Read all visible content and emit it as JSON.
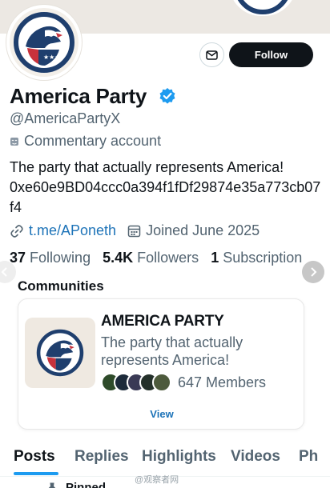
{
  "profile": {
    "name": "America Party",
    "handle": "@AmericaPartyX",
    "category": "Commentary account",
    "bio_line": "The party that actually represents America!",
    "bio_address": "0xe60e9BD04ccc0a394f1fDf29874e35a773cb07f4",
    "link": "t.me/APoneth",
    "joined": "Joined June 2025"
  },
  "actions": {
    "follow_label": "Follow"
  },
  "stats": {
    "following_count": "37",
    "following_label": "Following",
    "followers_count": "5.4K",
    "followers_label": "Followers",
    "subscriptions_count": "1",
    "subscriptions_label": "Subscription"
  },
  "communities": {
    "title": "Communities",
    "card": {
      "name": "AMERICA PARTY",
      "description": "The party that actually represents America!",
      "members": "647 Members",
      "view_label": "View"
    }
  },
  "tabs": [
    "Posts",
    "Replies",
    "Highlights",
    "Videos",
    "Ph"
  ],
  "pinned_label": "Pinned",
  "watermark": "@观察者网",
  "colors": {
    "brand_navy": "#1f3f6e",
    "brand_red": "#c8323c",
    "link_blue": "#1d73b8",
    "verified_blue": "#1d9bf0",
    "text_primary": "#0f1419",
    "text_secondary": "#536471"
  },
  "icons": [
    "verified-badge-icon",
    "mail-icon",
    "category-icon",
    "link-icon",
    "calendar-icon",
    "chevron-left-icon",
    "chevron-right-icon",
    "pin-icon"
  ]
}
